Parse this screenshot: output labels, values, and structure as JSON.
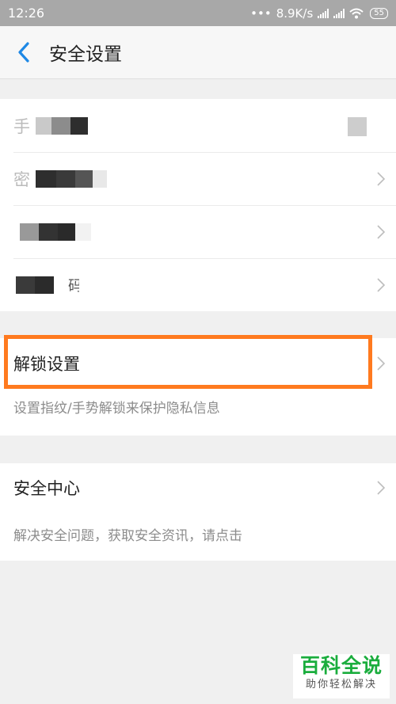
{
  "status_bar": {
    "time": "12:26",
    "network_speed": "8.9K/s",
    "battery": "55",
    "icons": [
      "dots-icon",
      "signal-icon",
      "signal-icon",
      "wifi-icon",
      "battery-icon"
    ]
  },
  "header": {
    "title": "安全设置",
    "back_icon": "chevron-left-icon"
  },
  "account_rows": {
    "row1_left_char": "手",
    "row2_left_char": "密",
    "row3_left_char": "「",
    "row4_right_char": "码"
  },
  "unlock_section": {
    "title": "解锁设置",
    "description": "设置指纹/手势解锁来保护隐私信息"
  },
  "security_center_section": {
    "title": "安全中心",
    "description": "解决安全问题，获取安全资讯，请点击"
  },
  "watermark": {
    "title": "百科全说",
    "subtitle": "助你轻松解决"
  },
  "colors": {
    "accent_blue": "#1e88e5",
    "highlight_orange": "#ff7a1f",
    "watermark_green": "#1aad3d"
  }
}
